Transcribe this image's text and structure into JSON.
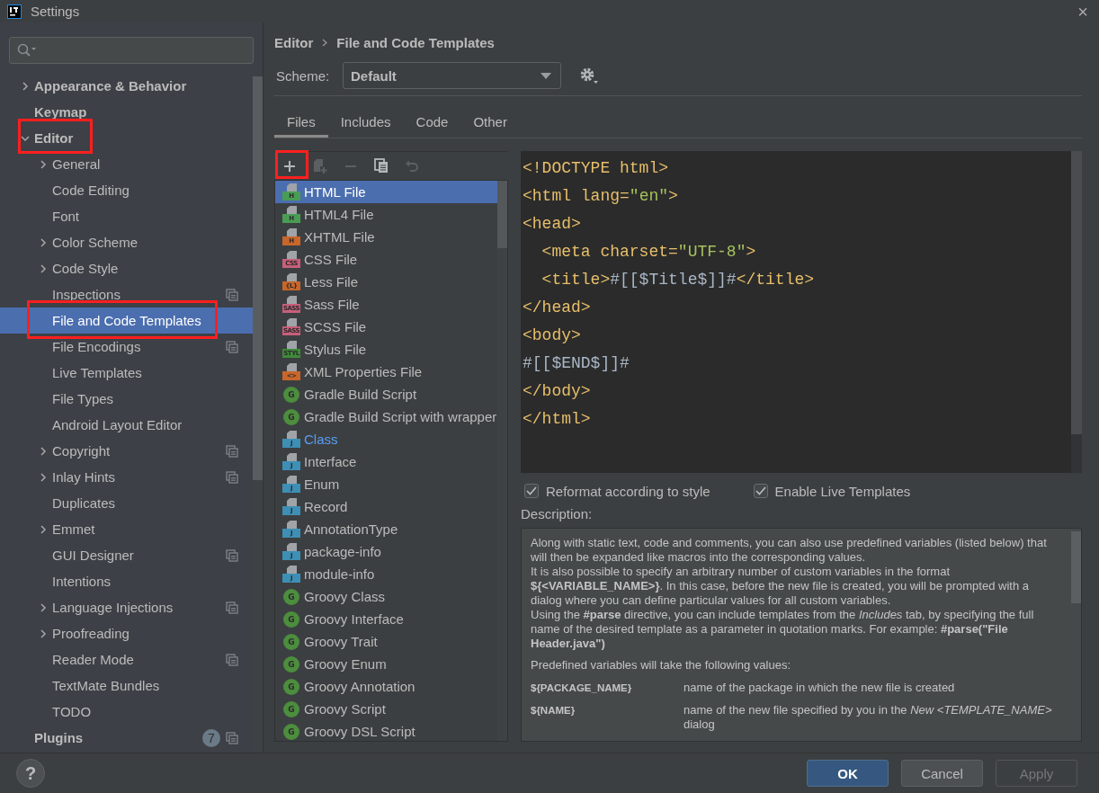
{
  "window": {
    "title": "Settings",
    "close": "×"
  },
  "sidebar": {
    "items": [
      {
        "label": "Appearance & Behavior",
        "expanded": false,
        "selected": false
      },
      {
        "label": "Keymap",
        "selected": false
      },
      {
        "label": "Editor",
        "expanded": true,
        "selected": false,
        "highlighted": true,
        "children": [
          {
            "label": "General",
            "expanded": false,
            "selected": false
          },
          {
            "label": "Code Editing",
            "selected": false
          },
          {
            "label": "Font",
            "selected": false
          },
          {
            "label": "Color Scheme",
            "expanded": false,
            "selected": false
          },
          {
            "label": "Code Style",
            "expanded": false,
            "selected": false
          },
          {
            "label": "Inspections",
            "selected": false,
            "project_icon": true
          },
          {
            "label": "File and Code Templates",
            "selected": true,
            "highlighted": true
          },
          {
            "label": "File Encodings",
            "selected": false,
            "project_icon": true
          },
          {
            "label": "Live Templates",
            "selected": false
          },
          {
            "label": "File Types",
            "selected": false
          },
          {
            "label": "Android Layout Editor",
            "selected": false
          },
          {
            "label": "Copyright",
            "expanded": false,
            "selected": false,
            "project_icon": true
          },
          {
            "label": "Inlay Hints",
            "expanded": false,
            "selected": false,
            "project_icon": true
          },
          {
            "label": "Duplicates",
            "selected": false
          },
          {
            "label": "Emmet",
            "expanded": false,
            "selected": false
          },
          {
            "label": "GUI Designer",
            "selected": false,
            "project_icon": true
          },
          {
            "label": "Intentions",
            "selected": false
          },
          {
            "label": "Language Injections",
            "expanded": false,
            "selected": false,
            "project_icon": true
          },
          {
            "label": "Proofreading",
            "expanded": false,
            "selected": false
          },
          {
            "label": "Reader Mode",
            "selected": false,
            "project_icon": true
          },
          {
            "label": "TextMate Bundles",
            "selected": false
          },
          {
            "label": "TODO",
            "selected": false
          }
        ]
      },
      {
        "label": "Plugins",
        "selected": false,
        "badge": "7",
        "project_icon": true
      }
    ]
  },
  "breadcrumb": [
    "Editor",
    "File and Code Templates"
  ],
  "scheme": {
    "label": "Scheme:",
    "value": "Default"
  },
  "tabs": [
    {
      "label": "Files",
      "selected": true
    },
    {
      "label": "Includes",
      "selected": false
    },
    {
      "label": "Code",
      "selected": false
    },
    {
      "label": "Other",
      "selected": false
    }
  ],
  "toolbar": [
    {
      "kind": "add",
      "disabled": false,
      "highlighted": true
    },
    {
      "kind": "add-child",
      "disabled": true
    },
    {
      "kind": "remove",
      "disabled": true
    },
    {
      "kind": "copy",
      "disabled": false
    },
    {
      "kind": "revert",
      "disabled": true
    }
  ],
  "templates": [
    {
      "name": "HTML File",
      "kind": "file",
      "badge": "H",
      "color": "#499c54",
      "selected": true
    },
    {
      "name": "HTML4 File",
      "kind": "file",
      "badge": "H",
      "color": "#499c54",
      "selected": false
    },
    {
      "name": "XHTML File",
      "kind": "file",
      "badge": "H",
      "color": "#c9662a",
      "selected": false
    },
    {
      "name": "CSS File",
      "kind": "file",
      "badge": "CSS",
      "color": "#c75f7a",
      "selected": false
    },
    {
      "name": "Less File",
      "kind": "file",
      "badge": "{L}",
      "color": "#c9662a",
      "selected": false
    },
    {
      "name": "Sass File",
      "kind": "file",
      "badge": "SASS",
      "color": "#c75f7a",
      "selected": false
    },
    {
      "name": "SCSS File",
      "kind": "file",
      "badge": "SASS",
      "color": "#c75f7a",
      "selected": false
    },
    {
      "name": "Stylus File",
      "kind": "file",
      "badge": "STYL",
      "color": "#3f8a3a",
      "selected": false
    },
    {
      "name": "XML Properties File",
      "kind": "file",
      "badge": "<>",
      "color": "#c9662a",
      "selected": false
    },
    {
      "name": "Gradle Build Script",
      "kind": "circle",
      "badge": "G",
      "color": "#4c8d3e",
      "selected": false
    },
    {
      "name": "Gradle Build Script with wrapper",
      "kind": "circle",
      "badge": "G",
      "color": "#4c8d3e",
      "selected": false
    },
    {
      "name": "Class",
      "kind": "file",
      "badge": "J",
      "color": "#3d8fb5",
      "selected": false,
      "modified": true
    },
    {
      "name": "Interface",
      "kind": "file",
      "badge": "J",
      "color": "#3d8fb5",
      "selected": false
    },
    {
      "name": "Enum",
      "kind": "file",
      "badge": "J",
      "color": "#3d8fb5",
      "selected": false
    },
    {
      "name": "Record",
      "kind": "file",
      "badge": "J",
      "color": "#3d8fb5",
      "selected": false
    },
    {
      "name": "AnnotationType",
      "kind": "file",
      "badge": "J",
      "color": "#3d8fb5",
      "selected": false
    },
    {
      "name": "package-info",
      "kind": "file",
      "badge": "J",
      "color": "#3d8fb5",
      "selected": false
    },
    {
      "name": "module-info",
      "kind": "file",
      "badge": "J",
      "color": "#3d8fb5",
      "selected": false
    },
    {
      "name": "Groovy Class",
      "kind": "circle",
      "badge": "G",
      "color": "#4c8d3e",
      "selected": false
    },
    {
      "name": "Groovy Interface",
      "kind": "circle",
      "badge": "G",
      "color": "#4c8d3e",
      "selected": false
    },
    {
      "name": "Groovy Trait",
      "kind": "circle",
      "badge": "G",
      "color": "#4c8d3e",
      "selected": false
    },
    {
      "name": "Groovy Enum",
      "kind": "circle",
      "badge": "G",
      "color": "#4c8d3e",
      "selected": false
    },
    {
      "name": "Groovy Annotation",
      "kind": "circle",
      "badge": "G",
      "color": "#4c8d3e",
      "selected": false
    },
    {
      "name": "Groovy Script",
      "kind": "circle",
      "badge": "G",
      "color": "#4c8d3e",
      "selected": false
    },
    {
      "name": "Groovy DSL Script",
      "kind": "circle",
      "badge": "G",
      "color": "#4c8d3e",
      "selected": false
    }
  ],
  "code": [
    [
      {
        "kind": "tag",
        "text": "<!DOCTYPE html>"
      }
    ],
    [
      {
        "kind": "tag",
        "text": "<html lang="
      },
      {
        "kind": "value",
        "text": "\"en\""
      },
      {
        "kind": "tag",
        "text": ">"
      }
    ],
    [
      {
        "kind": "tag",
        "text": "<head>"
      }
    ],
    [
      {
        "kind": "tag",
        "text": "  <meta charset="
      },
      {
        "kind": "value",
        "text": "\"UTF-8\""
      },
      {
        "kind": "tag",
        "text": ">"
      }
    ],
    [
      {
        "kind": "tag",
        "text": "  <title>"
      },
      {
        "kind": "text",
        "text": "#[[$Title$]]#"
      },
      {
        "kind": "tag",
        "text": "</title>"
      }
    ],
    [
      {
        "kind": "tag",
        "text": "</head>"
      }
    ],
    [
      {
        "kind": "tag",
        "text": "<body>"
      }
    ],
    [
      {
        "kind": "text",
        "text": "#[[$END$]]#"
      }
    ],
    [
      {
        "kind": "tag",
        "text": "</body>"
      }
    ],
    [
      {
        "kind": "tag",
        "text": "</html>"
      }
    ]
  ],
  "options": [
    {
      "label": "Reformat according to style",
      "checked": true
    },
    {
      "label": "Enable Live Templates",
      "checked": true
    }
  ],
  "description": {
    "label": "Description:",
    "paragraphs": [
      "Along with static text, code and comments, you can also use predefined variables (listed below) that will then be expanded like macros into the corresponding values.",
      "It is also possible to specify an arbitrary number of custom variables in the format **${<VARIABLE_NAME>}**. In this case, before the new file is created, you will be prompted with a dialog where you can define particular values for all custom variables.",
      "Using the **#parse** directive, you can include templates from the *Includes* tab, by specifying the full name of the desired template as a parameter in quotation marks. For example: **#parse(\"File Header.java\")**"
    ],
    "intro": "Predefined variables will take the following values:",
    "variables": [
      {
        "name": "${PACKAGE_NAME}",
        "meaning": "name of the package in which the new file is created"
      },
      {
        "name": "${NAME}",
        "meaning": "name of the new file specified by you in the *New <TEMPLATE_NAME>* dialog"
      }
    ]
  },
  "help": "?",
  "buttons": [
    {
      "label": "OK",
      "kind": "default",
      "disabled": false
    },
    {
      "label": "Cancel",
      "kind": "normal",
      "disabled": false
    },
    {
      "label": "Apply",
      "kind": "normal",
      "disabled": true
    }
  ]
}
